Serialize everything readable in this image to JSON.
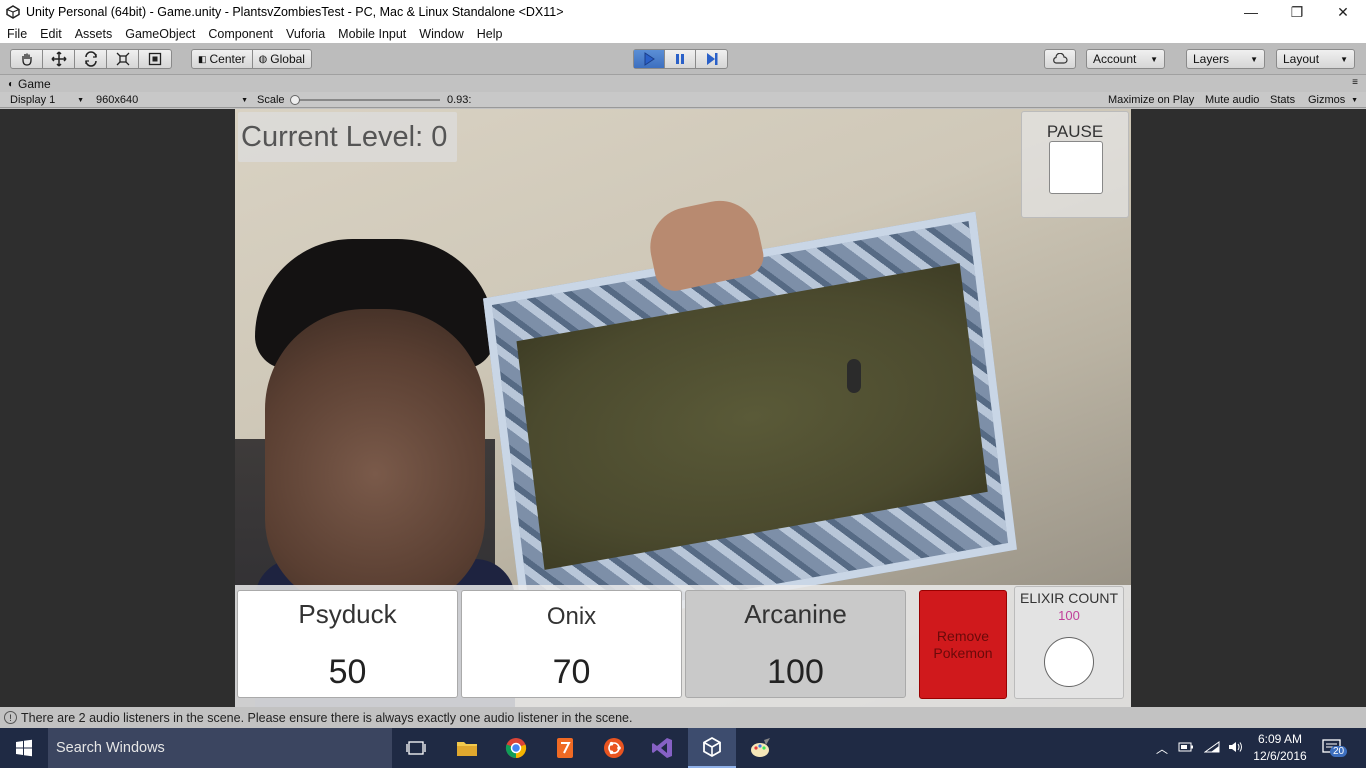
{
  "window": {
    "title": "Unity Personal (64bit) - Game.unity - PlantsvZombiesTest - PC, Mac & Linux Standalone <DX11>",
    "minimize": "—",
    "maximize": "❐",
    "close": "✕"
  },
  "menu": [
    "File",
    "Edit",
    "Assets",
    "GameObject",
    "Component",
    "Vuforia",
    "Mobile Input",
    "Window",
    "Help"
  ],
  "toolbar": {
    "tools": [
      "hand-icon",
      "move-icon",
      "rotate-icon",
      "scale-icon",
      "rect-icon"
    ],
    "pivot_center": "Center",
    "pivot_global": "Global",
    "account": "Account",
    "layers": "Layers",
    "layout": "Layout"
  },
  "game_tab": {
    "label": "Game",
    "display": "Display 1",
    "resolution": "960x640",
    "scale_label": "Scale",
    "scale_value": "0.93:",
    "maximize_on_play": "Maximize on Play",
    "mute_audio": "Mute audio",
    "stats": "Stats",
    "gizmos": "Gizmos"
  },
  "hud": {
    "level": "Current Level: 0",
    "pause": "PAUSE",
    "cards": [
      {
        "name": "Psyduck",
        "cost": "50"
      },
      {
        "name": "Onix",
        "cost": "70"
      },
      {
        "name": "Arcanine",
        "cost": "100"
      }
    ],
    "remove_line1": "Remove",
    "remove_line2": "Pokemon",
    "elixir_label": "ELIXIR COUNT",
    "elixir_value": "100"
  },
  "status": {
    "message": "There are 2 audio listeners in the scene. Please ensure there is always exactly one audio listener in the scene."
  },
  "taskbar": {
    "search_placeholder": "Search Windows",
    "time": "6:09 AM",
    "date": "12/6/2016",
    "notifications": "20"
  },
  "colors": {
    "play_active": "#4a7fd0",
    "remove_button": "#d0191c",
    "elixir_value": "#c0409a",
    "taskbar": "#1f2a44"
  }
}
